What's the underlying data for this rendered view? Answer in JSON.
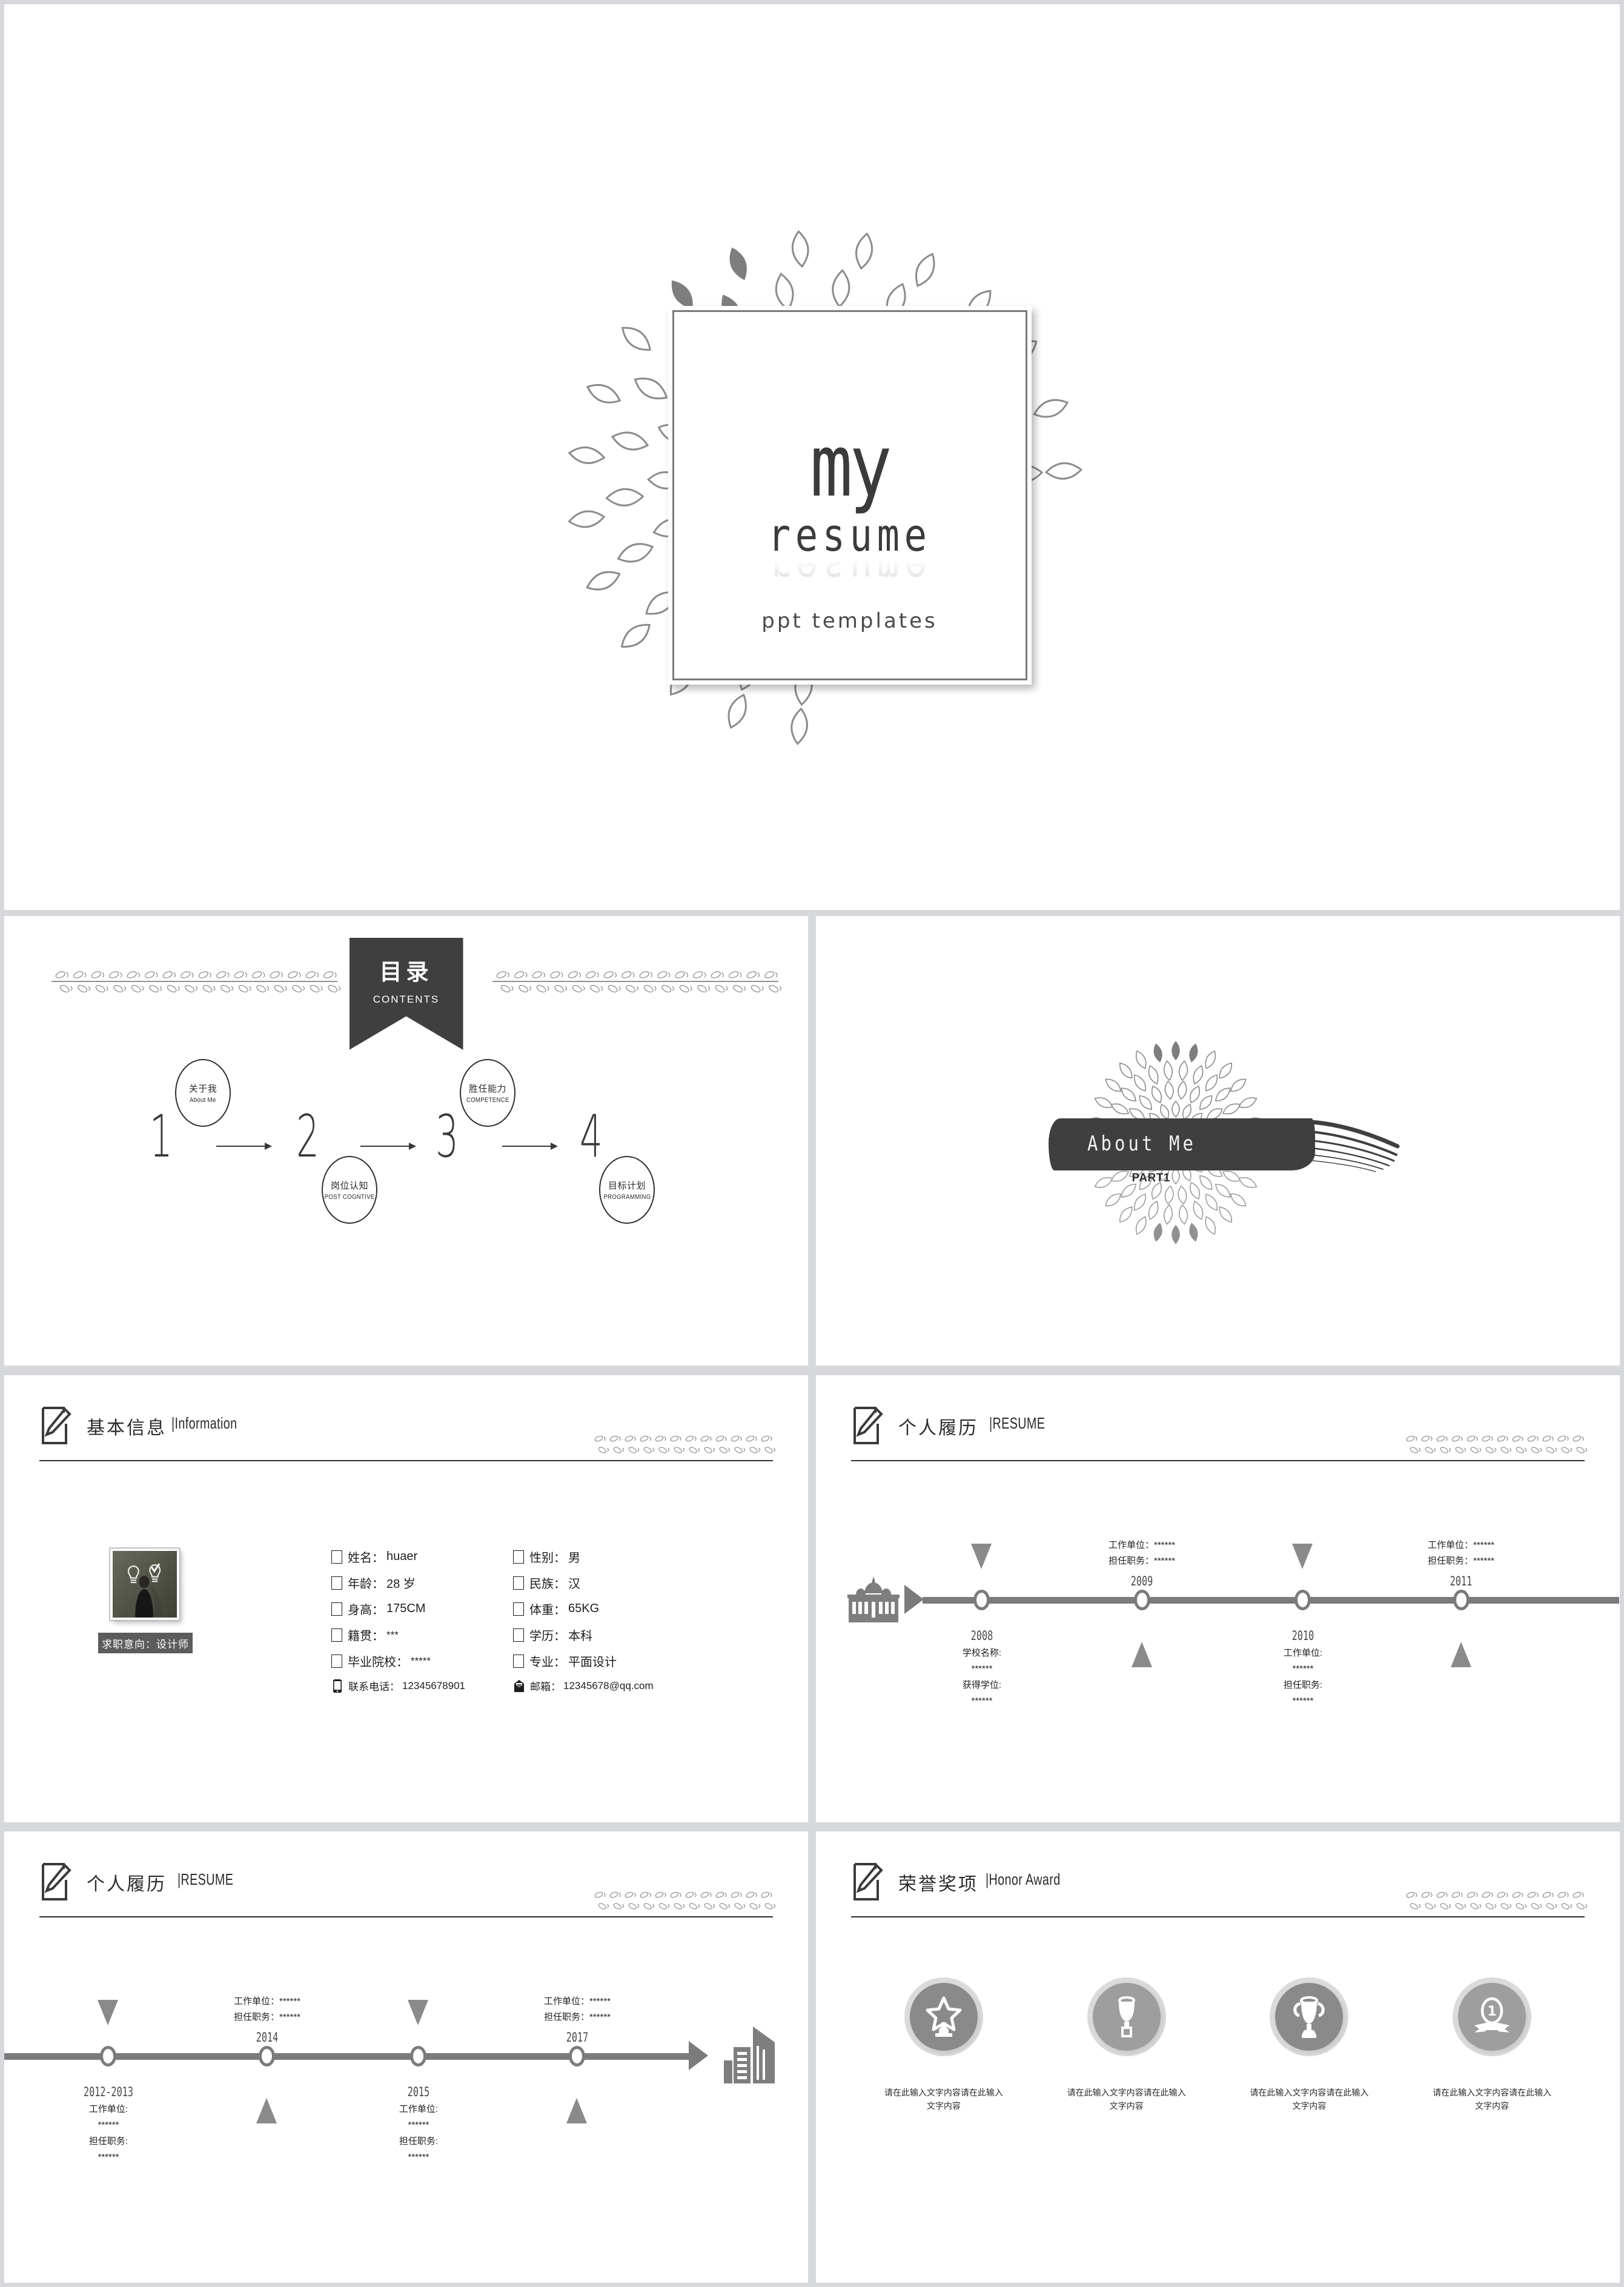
{
  "cover": {
    "title_main": "my",
    "title_sub": "resume",
    "tagline": "ppt templates"
  },
  "contents": {
    "ribbon_cn": "目录",
    "ribbon_en": "CONTENTS",
    "numbers": [
      "1",
      "2",
      "3",
      "4"
    ],
    "items": [
      {
        "cn": "关于我",
        "en": "About  Me"
      },
      {
        "cn": "岗位认知",
        "en": "POST COGNTIVE"
      },
      {
        "cn": "胜任能力",
        "en": "COMPETENCE"
      },
      {
        "cn": "目标计划",
        "en": "PROGRAMMING"
      }
    ]
  },
  "about": {
    "title": "About  Me",
    "part": "PART1"
  },
  "info": {
    "header_cn": "基本信息",
    "header_en": "|Information",
    "job_label": "求职意向：设计师",
    "fields": [
      {
        "label": "姓名：",
        "value": "huaer",
        "icon": "checkbox-icon"
      },
      {
        "label": "性别：",
        "value": "男",
        "icon": "checkbox-icon"
      },
      {
        "label": "年龄：",
        "value": "28 岁",
        "icon": "checkbox-icon"
      },
      {
        "label": "民族：",
        "value": "汉",
        "icon": "checkbox-icon"
      },
      {
        "label": "身高：",
        "value": "175CM",
        "icon": "checkbox-icon"
      },
      {
        "label": "体重：",
        "value": "65KG",
        "icon": "checkbox-icon"
      },
      {
        "label": "籍贯：",
        "value": "***",
        "icon": "checkbox-icon"
      },
      {
        "label": "学历：",
        "value": "本科",
        "icon": "checkbox-icon"
      },
      {
        "label": "毕业院校：",
        "value": "*****",
        "icon": "checkbox-icon"
      },
      {
        "label": "专业：",
        "value": "平面设计",
        "icon": "checkbox-icon"
      },
      {
        "label": "联系电话：",
        "value": "12345678901",
        "icon": "phone-icon"
      },
      {
        "label": "邮箱：",
        "value": "12345678@qq.com",
        "icon": "envelope-icon"
      }
    ]
  },
  "resume1": {
    "header_cn": "个人履历",
    "header_en": "|RESUME",
    "entries": [
      {
        "year": "2008",
        "side": "below",
        "lines": [
          "学校名称:",
          "******",
          "获得学位:",
          "******"
        ]
      },
      {
        "year": "2009",
        "side": "above",
        "lines": [
          "工作单位：******",
          "担任职务：******"
        ]
      },
      {
        "year": "2010",
        "side": "below",
        "lines": [
          "工作单位:",
          "******",
          "担任职务:",
          "******"
        ]
      },
      {
        "year": "2011",
        "side": "above",
        "lines": [
          "工作单位：******",
          "担任职务：******"
        ]
      }
    ]
  },
  "resume2": {
    "header_cn": "个人履历",
    "header_en": "|RESUME",
    "entries": [
      {
        "year": "2012-2013",
        "side": "below",
        "lines": [
          "工作单位:",
          "******",
          "担任职务:",
          "******"
        ]
      },
      {
        "year": "2014",
        "side": "above",
        "lines": [
          "工作单位：******",
          "担任职务：******"
        ]
      },
      {
        "year": "2015",
        "side": "below",
        "lines": [
          "工作单位:",
          "******",
          "担任职务:",
          "******"
        ]
      },
      {
        "year": "2017",
        "side": "above",
        "lines": [
          "工作单位：******",
          "担任职务：******"
        ]
      }
    ]
  },
  "honor": {
    "header_cn": "荣誉奖项",
    "header_en": "|Honor Award",
    "awards": [
      {
        "icon": "star-trophy-icon",
        "color": "#8a8a8a",
        "caption": "请在此输入文字内容请在此输入文字内容"
      },
      {
        "icon": "cup-trophy-icon",
        "color": "#9e9e9e",
        "caption": "请在此输入文字内容请在此输入文字内容"
      },
      {
        "icon": "handle-trophy-icon",
        "color": "#8a8a8a",
        "caption": "请在此输入文字内容请在此输入文字内容"
      },
      {
        "icon": "medal-first-icon",
        "color": "#9e9e9e",
        "caption": "请在此输入文字内容请在此输入文字内容"
      }
    ]
  },
  "colors": {
    "ink": "#3f3f3f",
    "rule": "#2e2e2e",
    "timeline": "#7b7b7b",
    "marker": "#8a8a8a",
    "page_bg": "#d6d8dc"
  }
}
